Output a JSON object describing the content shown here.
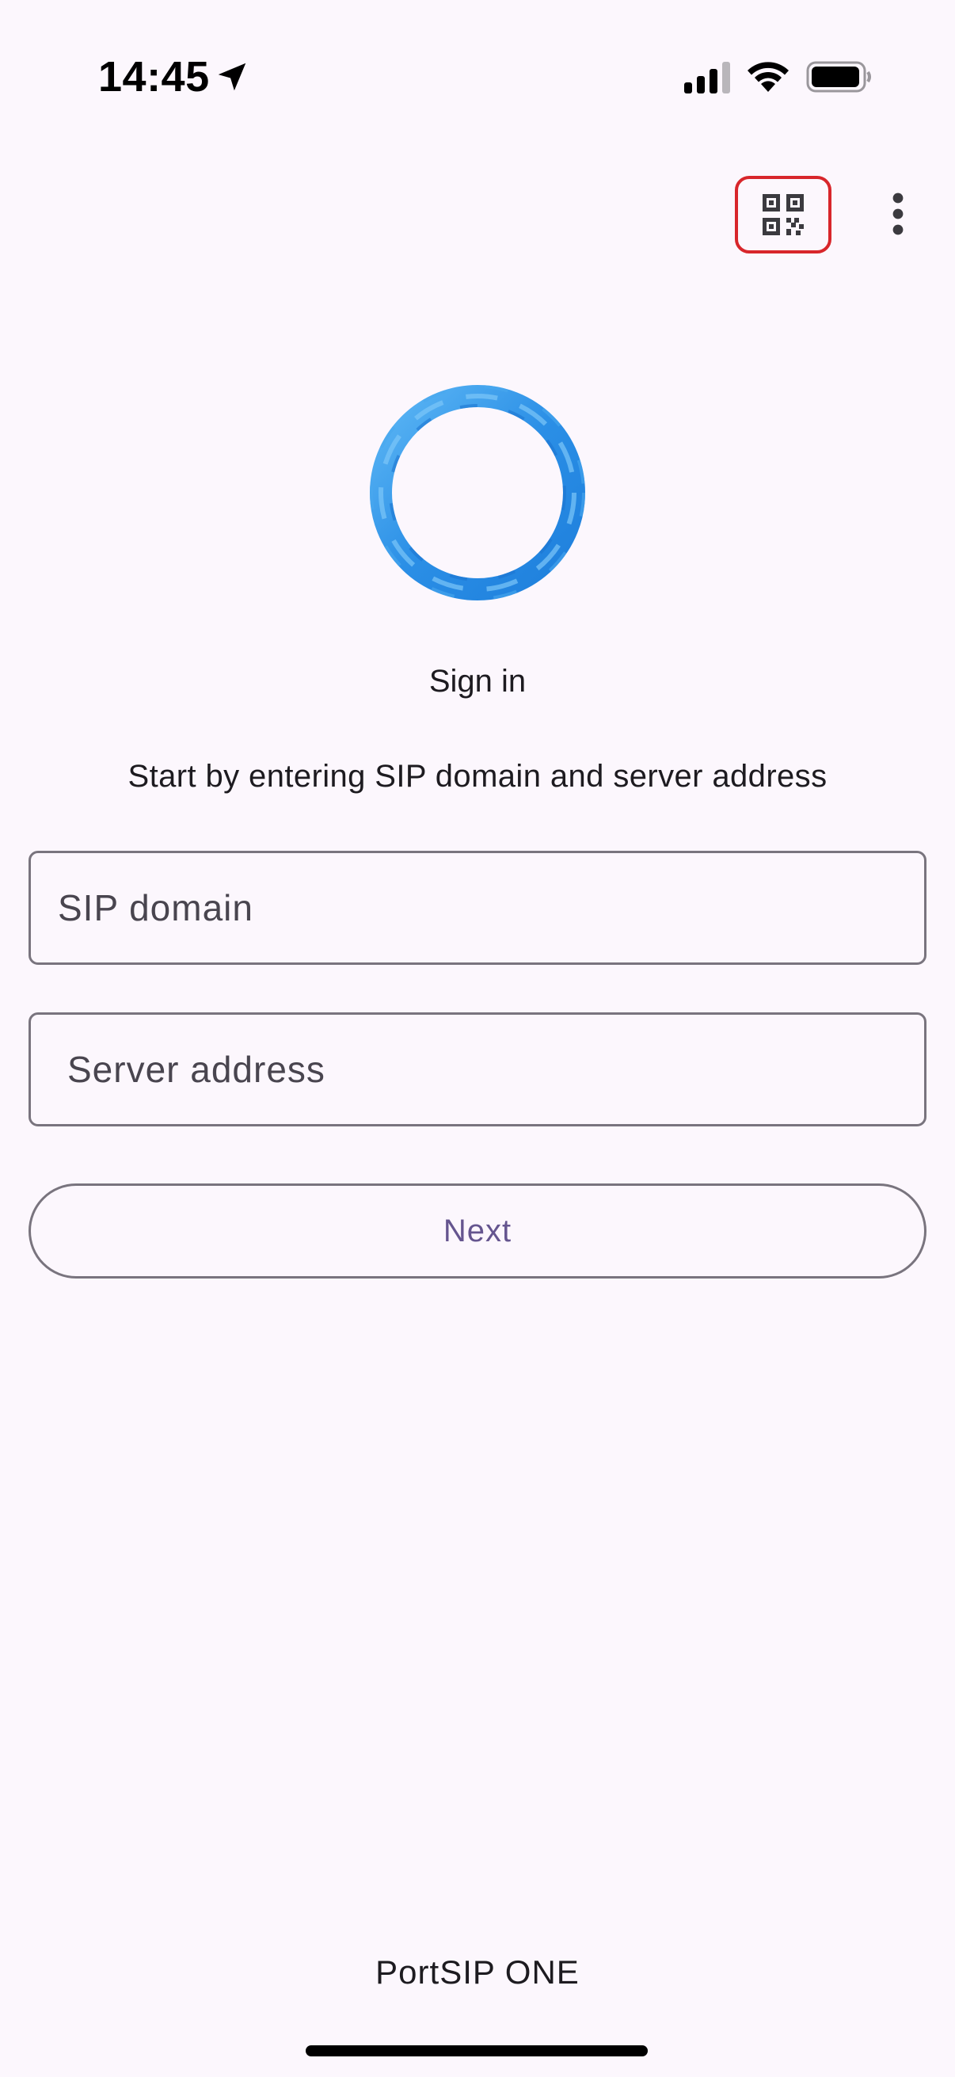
{
  "status_bar": {
    "time": "14:45",
    "icons": [
      "location-arrow-icon",
      "cellular-signal-icon",
      "wifi-icon",
      "battery-icon"
    ]
  },
  "toolbar": {
    "qr_icon": "qr-code-icon",
    "more_icon": "more-vertical-icon",
    "highlight_color": "#d8262b"
  },
  "logo": {
    "icon": "portsip-ring-logo",
    "color": "#2b8fe6"
  },
  "signin": {
    "title": "Sign in",
    "subtitle": "Start by entering SIP domain and server address",
    "sip_domain": {
      "placeholder": "SIP domain",
      "value": ""
    },
    "server_address": {
      "placeholder": "Server address",
      "value": ""
    },
    "next_label": "Next"
  },
  "footer": {
    "brand": "PortSIP ONE"
  },
  "colors": {
    "background": "#fcf7fd",
    "outline": "#79747e",
    "primary_text": "#65558f"
  }
}
